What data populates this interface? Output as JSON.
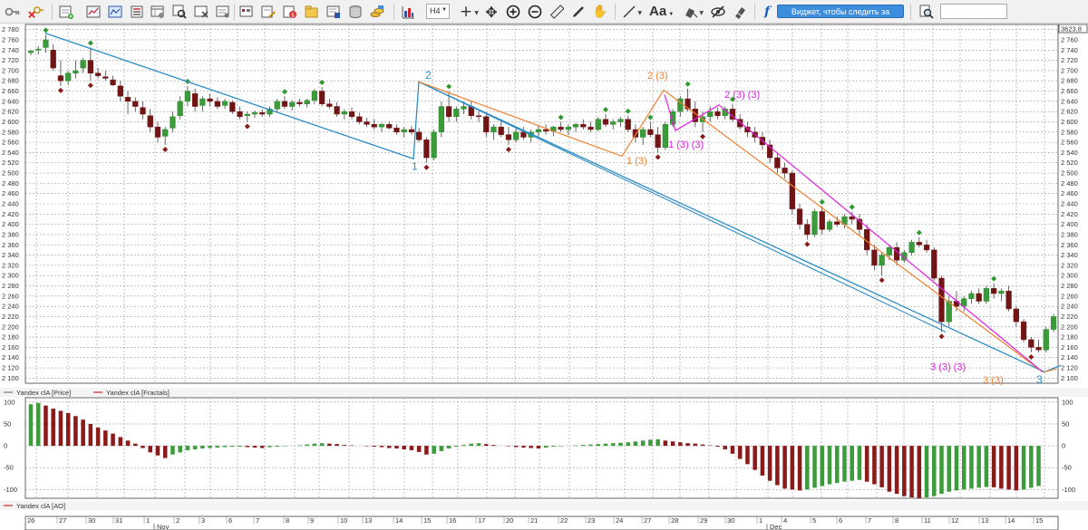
{
  "toolbar": {
    "timeframe": "H4",
    "font_label": "Aa",
    "widget_button": "Виджет, чтобы следить за рисками",
    "search_placeholder": ""
  },
  "chart": {
    "last_price_box": "3623.8",
    "price_ticks": [
      "2 780",
      "2 760",
      "2 740",
      "2 720",
      "2 700",
      "2 680",
      "2 660",
      "2 640",
      "2 620",
      "2 600",
      "2 580",
      "2 560",
      "2 540",
      "2 520",
      "2 500",
      "2 480",
      "2 460",
      "2 440",
      "2 420",
      "2 400",
      "2 380",
      "2 360",
      "2 340",
      "2 320",
      "2 300",
      "2 280",
      "2 260",
      "2 240",
      "2 220",
      "2 200",
      "2 180",
      "2 160",
      "2 140",
      "2 120",
      "2 100"
    ],
    "legend_price": "Yandex clA [Price]",
    "legend_fractals": "Yandex clA [Fractals]",
    "legend_ao": "Yandex clA [AO]",
    "ao_ticks": [
      "100",
      "50",
      "0",
      "-50",
      "-100"
    ],
    "date_labels": [
      "26",
      "27",
      "30",
      "31",
      "1",
      "2",
      "3",
      "6",
      "7",
      "8",
      "9",
      "10",
      "13",
      "14",
      "15",
      "16",
      "17",
      "20",
      "21",
      "22",
      "23",
      "24",
      "27",
      "28",
      "29",
      "30",
      "1",
      "4",
      "5",
      "6",
      "7",
      "8",
      "11",
      "12",
      "13",
      "14",
      "15"
    ],
    "month_labels": [
      "Nov",
      "Dec"
    ],
    "wave_labels": {
      "blue_1": "1",
      "blue_2": "2",
      "blue_3": "3",
      "orange_1": "1 (3)",
      "orange_2": "2 (3)",
      "orange_3": "3 (3)",
      "magenta_1": "1 (3) (3)",
      "magenta_2": "2 (3) (3)",
      "magenta_3": "3 (3) (3)"
    },
    "colors": {
      "bull": "#2e8b2e",
      "bear": "#7b1a1a",
      "fractal_up": "#2e9a2e",
      "fractal_down": "#8b1a1a",
      "wave_blue": "#2b8cc4",
      "wave_orange": "#f08030",
      "wave_magenta": "#e020e0",
      "ao_up": "#3c9c3c",
      "ao_down": "#8b1a1a",
      "grid": "#9a9a9a"
    }
  },
  "chart_data": {
    "type": "candlestick",
    "ylim": [
      2090,
      2790
    ],
    "candles": [
      [
        2735,
        2740,
        2730,
        2738
      ],
      [
        2740,
        2748,
        2732,
        2742
      ],
      [
        2745,
        2770,
        2735,
        2760
      ],
      [
        2740,
        2752,
        2700,
        2705
      ],
      [
        2690,
        2720,
        2670,
        2680
      ],
      [
        2680,
        2700,
        2672,
        2695
      ],
      [
        2695,
        2720,
        2685,
        2700
      ],
      [
        2705,
        2725,
        2695,
        2720
      ],
      [
        2720,
        2745,
        2680,
        2695
      ],
      [
        2695,
        2705,
        2685,
        2690
      ],
      [
        2688,
        2700,
        2680,
        2685
      ],
      [
        2682,
        2690,
        2670,
        2672
      ],
      [
        2670,
        2680,
        2640,
        2650
      ],
      [
        2648,
        2660,
        2615,
        2640
      ],
      [
        2640,
        2648,
        2620,
        2630
      ],
      [
        2628,
        2640,
        2605,
        2615
      ],
      [
        2612,
        2625,
        2580,
        2590
      ],
      [
        2590,
        2600,
        2560,
        2570
      ],
      [
        2572,
        2590,
        2555,
        2585
      ],
      [
        2588,
        2620,
        2580,
        2610
      ],
      [
        2612,
        2650,
        2605,
        2640
      ],
      [
        2640,
        2670,
        2630,
        2660
      ],
      [
        2655,
        2665,
        2620,
        2630
      ],
      [
        2632,
        2650,
        2620,
        2645
      ],
      [
        2645,
        2655,
        2630,
        2640
      ],
      [
        2640,
        2648,
        2625,
        2630
      ],
      [
        2632,
        2645,
        2625,
        2640
      ],
      [
        2638,
        2642,
        2615,
        2620
      ],
      [
        2620,
        2630,
        2605,
        2610
      ],
      [
        2612,
        2620,
        2600,
        2615
      ],
      [
        2615,
        2622,
        2608,
        2618
      ],
      [
        2618,
        2625,
        2610,
        2615
      ],
      [
        2615,
        2630,
        2610,
        2625
      ],
      [
        2625,
        2645,
        2620,
        2640
      ],
      [
        2640,
        2650,
        2625,
        2630
      ],
      [
        2630,
        2642,
        2622,
        2638
      ],
      [
        2638,
        2645,
        2630,
        2635
      ],
      [
        2635,
        2645,
        2628,
        2642
      ],
      [
        2642,
        2665,
        2635,
        2660
      ],
      [
        2660,
        2668,
        2630,
        2635
      ],
      [
        2635,
        2645,
        2625,
        2630
      ],
      [
        2630,
        2638,
        2610,
        2615
      ],
      [
        2615,
        2625,
        2605,
        2620
      ],
      [
        2620,
        2628,
        2605,
        2610
      ],
      [
        2610,
        2618,
        2595,
        2600
      ],
      [
        2600,
        2608,
        2590,
        2595
      ],
      [
        2595,
        2605,
        2585,
        2590
      ],
      [
        2590,
        2598,
        2580,
        2595
      ],
      [
        2595,
        2600,
        2585,
        2588
      ],
      [
        2588,
        2595,
        2575,
        2580
      ],
      [
        2580,
        2590,
        2570,
        2585
      ],
      [
        2585,
        2592,
        2575,
        2580
      ],
      [
        2580,
        2588,
        2560,
        2565
      ],
      [
        2565,
        2570,
        2520,
        2530
      ],
      [
        2530,
        2585,
        2525,
        2580
      ],
      [
        2580,
        2640,
        2570,
        2630
      ],
      [
        2630,
        2660,
        2600,
        2610
      ],
      [
        2610,
        2630,
        2600,
        2625
      ],
      [
        2625,
        2640,
        2615,
        2630
      ],
      [
        2630,
        2640,
        2605,
        2612
      ],
      [
        2612,
        2620,
        2600,
        2610
      ],
      [
        2610,
        2615,
        2570,
        2580
      ],
      [
        2580,
        2595,
        2565,
        2590
      ],
      [
        2590,
        2600,
        2570,
        2575
      ],
      [
        2575,
        2590,
        2555,
        2565
      ],
      [
        2565,
        2590,
        2560,
        2580
      ],
      [
        2580,
        2590,
        2565,
        2570
      ],
      [
        2570,
        2585,
        2560,
        2580
      ],
      [
        2580,
        2592,
        2570,
        2585
      ],
      [
        2585,
        2595,
        2575,
        2582
      ],
      [
        2582,
        2592,
        2572,
        2590
      ],
      [
        2590,
        2600,
        2580,
        2585
      ],
      [
        2585,
        2595,
        2575,
        2590
      ],
      [
        2590,
        2598,
        2580,
        2595
      ],
      [
        2595,
        2605,
        2585,
        2590
      ],
      [
        2590,
        2600,
        2580,
        2585
      ],
      [
        2585,
        2610,
        2582,
        2605
      ],
      [
        2605,
        2615,
        2590,
        2595
      ],
      [
        2595,
        2605,
        2585,
        2600
      ],
      [
        2600,
        2610,
        2590,
        2605
      ],
      [
        2605,
        2612,
        2580,
        2585
      ],
      [
        2585,
        2595,
        2560,
        2570
      ],
      [
        2570,
        2590,
        2555,
        2585
      ],
      [
        2585,
        2600,
        2570,
        2575
      ],
      [
        2575,
        2590,
        2540,
        2550
      ],
      [
        2550,
        2600,
        2545,
        2595
      ],
      [
        2595,
        2625,
        2590,
        2620
      ],
      [
        2620,
        2650,
        2610,
        2645
      ],
      [
        2645,
        2665,
        2620,
        2625
      ],
      [
        2625,
        2640,
        2590,
        2600
      ],
      [
        2600,
        2620,
        2580,
        2610
      ],
      [
        2610,
        2630,
        2600,
        2620
      ],
      [
        2620,
        2628,
        2605,
        2612
      ],
      [
        2612,
        2630,
        2605,
        2625
      ],
      [
        2625,
        2635,
        2600,
        2605
      ],
      [
        2605,
        2615,
        2585,
        2590
      ],
      [
        2590,
        2600,
        2570,
        2580
      ],
      [
        2580,
        2590,
        2560,
        2570
      ],
      [
        2570,
        2580,
        2545,
        2555
      ],
      [
        2555,
        2565,
        2520,
        2530
      ],
      [
        2530,
        2540,
        2500,
        2510
      ],
      [
        2510,
        2520,
        2490,
        2500
      ],
      [
        2500,
        2505,
        2420,
        2430
      ],
      [
        2430,
        2440,
        2390,
        2400
      ],
      [
        2400,
        2410,
        2370,
        2380
      ],
      [
        2380,
        2430,
        2375,
        2425
      ],
      [
        2425,
        2435,
        2380,
        2390
      ],
      [
        2390,
        2410,
        2385,
        2405
      ],
      [
        2405,
        2415,
        2395,
        2400
      ],
      [
        2400,
        2420,
        2392,
        2415
      ],
      [
        2415,
        2425,
        2400,
        2410
      ],
      [
        2410,
        2420,
        2380,
        2390
      ],
      [
        2390,
        2400,
        2340,
        2350
      ],
      [
        2350,
        2360,
        2310,
        2320
      ],
      [
        2320,
        2345,
        2300,
        2340
      ],
      [
        2340,
        2360,
        2330,
        2355
      ],
      [
        2355,
        2365,
        2320,
        2330
      ],
      [
        2330,
        2350,
        2325,
        2345
      ],
      [
        2345,
        2370,
        2340,
        2365
      ],
      [
        2365,
        2375,
        2355,
        2360
      ],
      [
        2360,
        2370,
        2345,
        2350
      ],
      [
        2350,
        2355,
        2290,
        2295
      ],
      [
        2295,
        2300,
        2190,
        2210
      ],
      [
        2210,
        2260,
        2200,
        2250
      ],
      [
        2250,
        2270,
        2230,
        2240
      ],
      [
        2240,
        2260,
        2230,
        2255
      ],
      [
        2255,
        2270,
        2245,
        2265
      ],
      [
        2265,
        2275,
        2245,
        2250
      ],
      [
        2250,
        2280,
        2245,
        2275
      ],
      [
        2275,
        2285,
        2255,
        2265
      ],
      [
        2265,
        2275,
        2250,
        2270
      ],
      [
        2270,
        2280,
        2230,
        2235
      ],
      [
        2235,
        2240,
        2200,
        2210
      ],
      [
        2210,
        2215,
        2170,
        2175
      ],
      [
        2175,
        2180,
        2150,
        2160
      ],
      [
        2160,
        2175,
        2150,
        2155
      ],
      [
        2155,
        2200,
        2150,
        2195
      ],
      [
        2195,
        2225,
        2190,
        2220
      ]
    ],
    "ao_values": [
      95,
      98,
      92,
      85,
      80,
      75,
      68,
      60,
      50,
      42,
      35,
      28,
      20,
      12,
      5,
      -5,
      -15,
      -22,
      -28,
      -20,
      -15,
      -10,
      -8,
      -6,
      -5,
      -4,
      -3,
      -2,
      -2,
      -3,
      -4,
      -5,
      -3,
      -2,
      -1,
      0,
      1,
      3,
      5,
      6,
      5,
      4,
      2,
      1,
      0,
      -1,
      -2,
      -3,
      -5,
      -6,
      -8,
      -10,
      -14,
      -20,
      -18,
      -12,
      -6,
      -2,
      2,
      5,
      6,
      4,
      2,
      0,
      -1,
      -3,
      -4,
      -5,
      -6,
      -4,
      -2,
      -1,
      0,
      1,
      2,
      3,
      4,
      5,
      6,
      7,
      8,
      10,
      12,
      14,
      15,
      12,
      10,
      8,
      6,
      5,
      3,
      1,
      -2,
      -8,
      -18,
      -30,
      -42,
      -55,
      -68,
      -80,
      -90,
      -98,
      -100,
      -102,
      -100,
      -96,
      -92,
      -88,
      -85,
      -82,
      -80,
      -78,
      -82,
      -88,
      -95,
      -105,
      -110,
      -115,
      -118,
      -120,
      -118,
      -115,
      -110,
      -105,
      -102,
      -100,
      -98,
      -96,
      -94,
      -95,
      -98,
      -100,
      -102,
      -100,
      -96,
      -92
    ]
  }
}
